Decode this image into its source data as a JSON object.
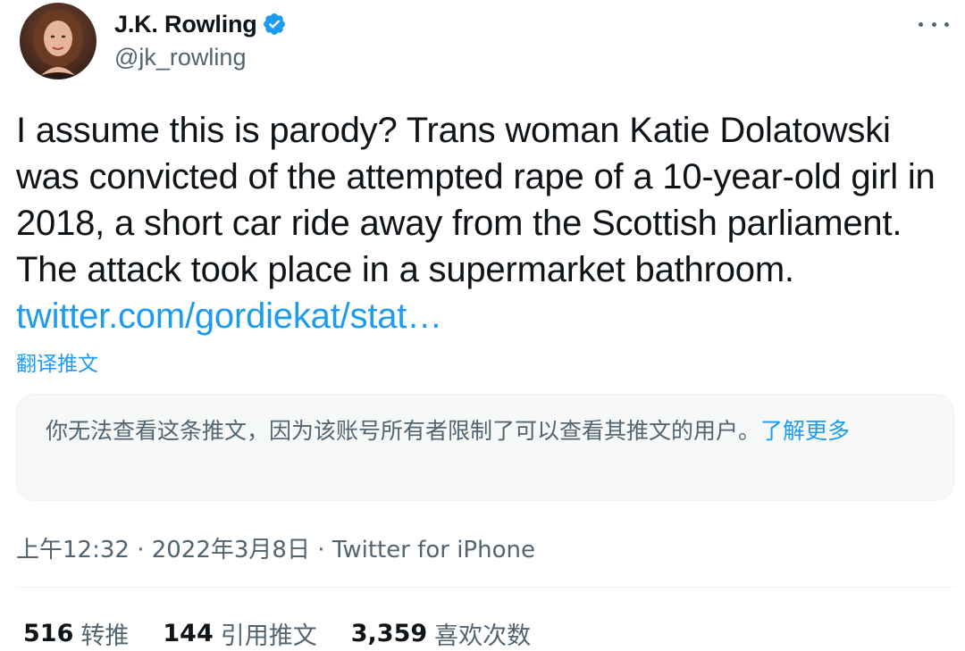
{
  "author": {
    "display_name": "J.K. Rowling",
    "handle": "@jk_rowling",
    "verified": true
  },
  "tweet": {
    "text": "I assume this is parody? Trans woman Katie Dolatowski was convicted of the attempted rape of a 10-year-old girl in 2018, a short car ride away from the Scottish parliament. The attack took place in a supermarket bathroom. ",
    "link": "twitter.com/gordiekat/stat…",
    "translate_label": "翻译推文"
  },
  "quote": {
    "message": "你无法查看这条推文，因为该账号所有者限制了可以查看其推文的用户。",
    "learn_more": "了解更多"
  },
  "meta": {
    "timestamp": "上午12:32 · 2022年3月8日 · Twitter for iPhone"
  },
  "stats": [
    {
      "count": "516",
      "label": "转推"
    },
    {
      "count": "144",
      "label": "引用推文"
    },
    {
      "count": "3,359",
      "label": "喜欢次数"
    }
  ],
  "icons": {
    "verified": "verified-badge-icon",
    "more": "more-horizontal-icon"
  },
  "colors": {
    "accent": "#1d9bf0",
    "text": "#0f1419",
    "secondary": "#536471"
  }
}
